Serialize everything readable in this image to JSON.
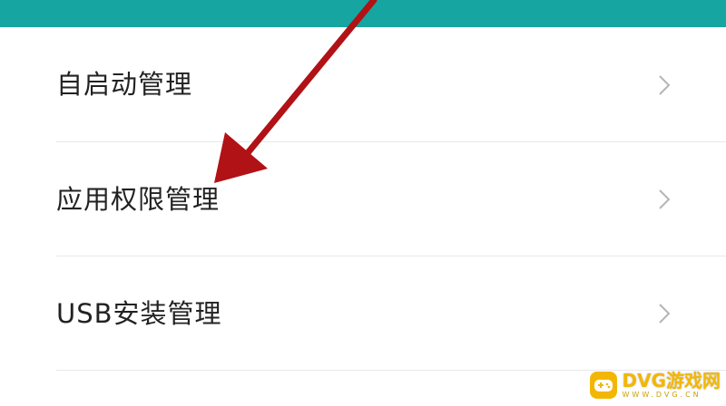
{
  "header": {
    "color": "#16a5a0"
  },
  "settings": {
    "items": [
      {
        "label": "自启动管理",
        "icon": "chevron-right-icon"
      },
      {
        "label": "应用权限管理",
        "icon": "chevron-right-icon"
      },
      {
        "label": "USB安装管理",
        "icon": "chevron-right-icon"
      }
    ]
  },
  "annotation": {
    "arrow_color": "#b01216",
    "points_to": "应用权限管理"
  },
  "watermark": {
    "title": "DVG游戏网",
    "subtitle": "WWW.DVG.CN",
    "icon": "gamepad-icon"
  }
}
